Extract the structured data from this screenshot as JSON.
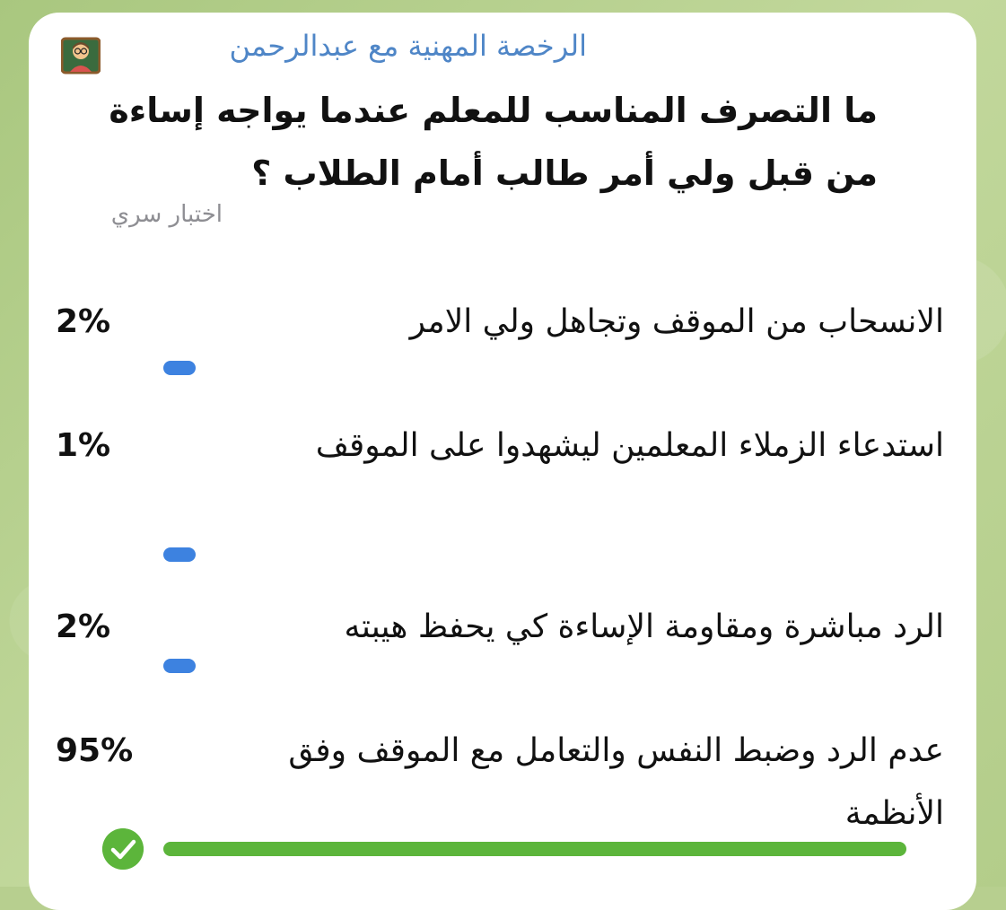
{
  "poll": {
    "sender_name": "الرخصة المهنية مع عبدالرحمن",
    "question": "ما التصرف المناسب للمعلم عندما يواجه إساءة من قبل ولي أمر طالب أمام الطلاب ؟",
    "quiz_type": "اختبار سري",
    "options": [
      {
        "text": "الانسحاب من الموقف وتجاهل ولي الامر",
        "percent": "2%",
        "value": 2,
        "correct": false
      },
      {
        "text": "استدعاء الزملاء المعلمين ليشهدوا على الموقف",
        "percent": "1%",
        "value": 1,
        "correct": false
      },
      {
        "text": "الرد مباشرة ومقاومة الإساءة كي يحفظ هيبته",
        "percent": "2%",
        "value": 2,
        "correct": false
      },
      {
        "text": "عدم الرد وضبط النفس والتعامل مع الموقف وفق الأنظمة",
        "percent": "95%",
        "value": 95,
        "correct": true
      }
    ]
  },
  "icons": {
    "avatar": "teacher-emoji-icon",
    "correct": "check-circle-icon"
  },
  "colors": {
    "sender": "#4f86c7",
    "bar": "#3d82e0",
    "correct": "#5cb53b",
    "muted": "#8e8e93"
  }
}
